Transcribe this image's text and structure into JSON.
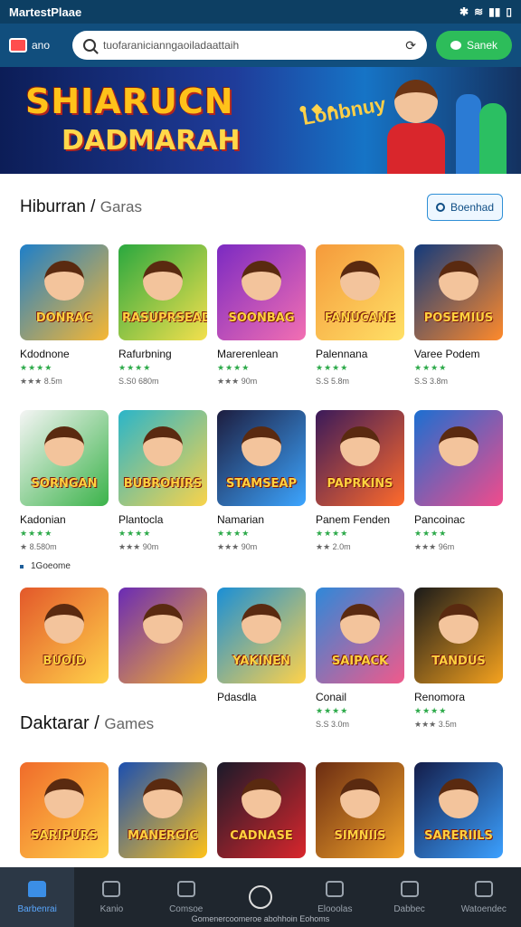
{
  "status_bar": {
    "app_label": "MartestPlaae",
    "right_icons": [
      "bluetooth-icon",
      "wifi-icon",
      "signal-icon",
      "battery-icon"
    ]
  },
  "header": {
    "store_name": "ano",
    "search_text": "tuofaranicianngaoiladaattaih",
    "go_button": "Sanek"
  },
  "banner": {
    "title_line1": "SHIARUCN",
    "title_line2": "DADMARAH",
    "tagline": "Lonbnuy"
  },
  "section1": {
    "title": "Hiburran",
    "subtitle": "Garas",
    "filter_button": "Boenhad",
    "rows": [
      [
        {
          "name": "Kdodnone",
          "art": "DONRAC",
          "stars": "★★★★",
          "meta": "★★★ 8.5m",
          "colors": [
            "#1e7fc9",
            "#f7b733"
          ]
        },
        {
          "name": "Rafurbning",
          "art": "RASUPRSEAD",
          "stars": "★★★★",
          "meta": "S.S0 680m",
          "colors": [
            "#2aa83f",
            "#f4e04d"
          ]
        },
        {
          "name": "Marerenlean",
          "art": "SOONBAG",
          "stars": "★★★★",
          "meta": "★★★ 90m",
          "colors": [
            "#7b2ac2",
            "#f36fb2"
          ]
        },
        {
          "name": "Palennana",
          "art": "FANUCANE",
          "stars": "★★★★",
          "meta": "S.S 5.8m",
          "colors": [
            "#f59a3b",
            "#ffe066"
          ]
        },
        {
          "name": "Varee Podem",
          "art": "POSEMIUS",
          "stars": "★★★★",
          "meta": "S.S 3.8m",
          "colors": [
            "#133a7c",
            "#ff8a2b"
          ]
        }
      ],
      [
        {
          "name": "Kadonian",
          "art": "SORNGAN",
          "stars": "★★★★",
          "meta": "★ 8.580m",
          "colors": [
            "#f5f5f5",
            "#3bb34a"
          ]
        },
        {
          "name": "Plantocla",
          "art": "BUBROHIRS",
          "stars": "★★★★",
          "meta": "★★★ 90m",
          "colors": [
            "#2bb5c9",
            "#f9d34a"
          ]
        },
        {
          "name": "Namarian",
          "art": "STAMSEAP",
          "stars": "★★★★",
          "meta": "★★★ 90m",
          "colors": [
            "#1d1d3f",
            "#3ca5ff"
          ]
        },
        {
          "name": "Panem Fenden",
          "art": "PAPRKINS",
          "stars": "★★★★",
          "meta": "★★ 2.0m",
          "colors": [
            "#3a1a5a",
            "#ff6a2b"
          ]
        },
        {
          "name": "Pancoinac",
          "art": "",
          "stars": "★★★★",
          "meta": "★★★ 96m",
          "colors": [
            "#1c6fd1",
            "#f24b8b"
          ]
        }
      ]
    ],
    "more_link": "1Goeome"
  },
  "section1b": {
    "apps": [
      {
        "name": "",
        "art": "BUOID",
        "stars": "",
        "meta": "",
        "colors": [
          "#e3582a",
          "#ffd24a"
        ]
      },
      {
        "name": "",
        "art": "",
        "stars": "",
        "meta": "",
        "colors": [
          "#6a2bb5",
          "#f8b02a"
        ]
      },
      {
        "name": "Pdasdla",
        "art": "YAKINEN",
        "stars": "",
        "meta": "",
        "colors": [
          "#1a8fd6",
          "#ffd24a"
        ]
      },
      {
        "name": "Conail",
        "art": "SAIPACK",
        "stars": "★★★★",
        "meta": "S.S 3.0m",
        "colors": [
          "#2f88d9",
          "#f05a8b"
        ]
      },
      {
        "name": "Renomora",
        "art": "TANDUS",
        "stars": "★★★★",
        "meta": "★★★ 3.5m",
        "colors": [
          "#1a1a1a",
          "#f5a21e"
        ]
      }
    ]
  },
  "section2": {
    "title": "Daktarar",
    "subtitle": "Games",
    "apps": [
      {
        "name": "",
        "art": "SARIPURS",
        "colors": [
          "#f06b2a",
          "#ffd24a"
        ]
      },
      {
        "name": "",
        "art": "MANERGIC",
        "colors": [
          "#1b4fb0",
          "#ffc21a"
        ]
      },
      {
        "name": "",
        "art": "CADNASE",
        "colors": [
          "#1a1a2a",
          "#d9262c"
        ]
      },
      {
        "name": "",
        "art": "SIMNIIS",
        "colors": [
          "#6b2c12",
          "#f2a32a"
        ]
      },
      {
        "name": "",
        "art": "SARERIILS",
        "colors": [
          "#141d4a",
          "#3ba0ff"
        ]
      }
    ]
  },
  "bottom_nav": {
    "items": [
      {
        "label": "Barbenrai",
        "icon": "home-icon"
      },
      {
        "label": "Kanio",
        "icon": "apps-icon"
      },
      {
        "label": "Comsoe",
        "icon": "gear-icon"
      },
      {
        "label": "",
        "icon": "clock-icon"
      },
      {
        "label": "Elooolas",
        "icon": "list-icon"
      },
      {
        "label": "Dabbec",
        "icon": "settings-icon"
      },
      {
        "label": "Watoendec",
        "icon": "profile-icon"
      }
    ],
    "footer": "Gomenercoomeroe abohhoin Eohoms"
  }
}
